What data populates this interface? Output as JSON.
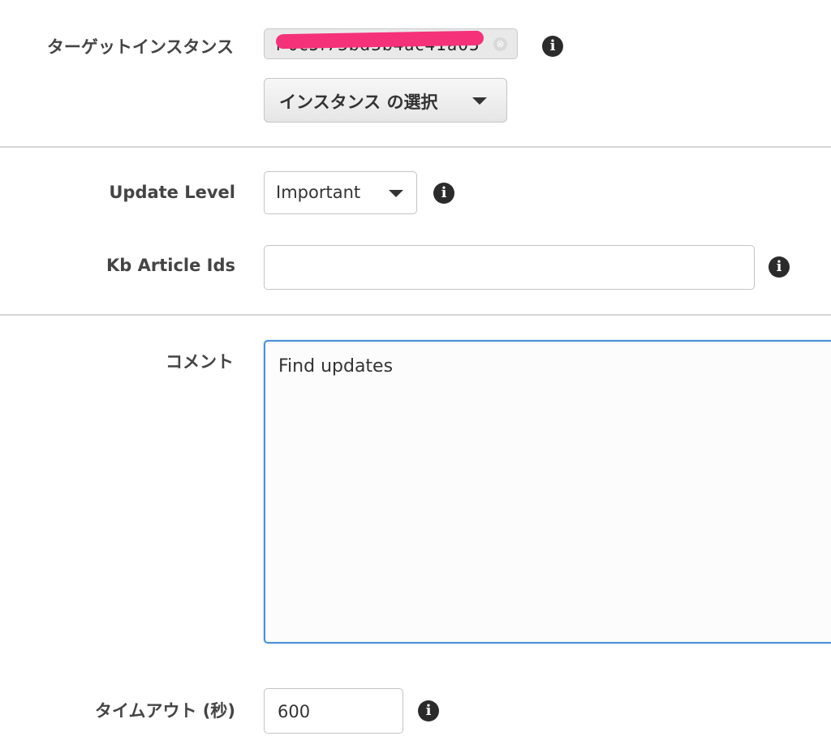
{
  "target_instance": {
    "label": "ターゲットインスタンス",
    "token_text": "i-0c5f73bd3b4ac41a05",
    "remove_glyph": "⊗",
    "select_button_label": "インスタンス の選択"
  },
  "update_level": {
    "label": "Update Level",
    "selected": "Important"
  },
  "kb_article_ids": {
    "label": "Kb Article Ids",
    "value": ""
  },
  "comment": {
    "label": "コメント",
    "value": "Find updates"
  },
  "timeout": {
    "label": "タイムアウト (秒)",
    "value": "600"
  },
  "icons": {
    "info": "i",
    "info_icon_name": "info-circle-icon",
    "caret_icon_name": "caret-down-icon"
  },
  "colors": {
    "redaction": "#f5317a",
    "focus_border": "#4a90d9"
  }
}
